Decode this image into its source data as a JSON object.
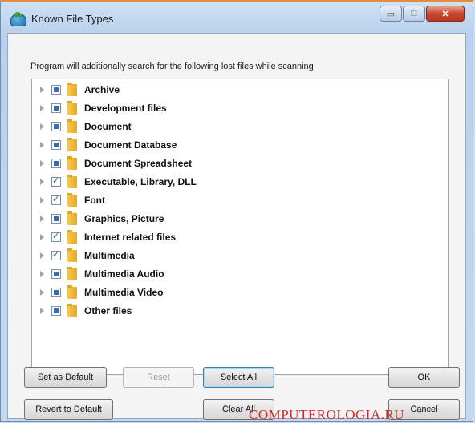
{
  "window": {
    "title": "Known File Types",
    "minimize_glyph": "▭",
    "maximize_glyph": "□",
    "close_glyph": "✕"
  },
  "instruction": "Program will additionally search for the following lost files while scanning",
  "file_types": [
    {
      "label": "Archive",
      "state": "partial"
    },
    {
      "label": "Development files",
      "state": "partial"
    },
    {
      "label": "Document",
      "state": "partial"
    },
    {
      "label": "Document Database",
      "state": "partial"
    },
    {
      "label": "Document Spreadsheet",
      "state": "partial"
    },
    {
      "label": "Executable, Library, DLL",
      "state": "checked"
    },
    {
      "label": "Font",
      "state": "checked"
    },
    {
      "label": "Graphics, Picture",
      "state": "partial"
    },
    {
      "label": "Internet related files",
      "state": "checked"
    },
    {
      "label": "Multimedia",
      "state": "checked"
    },
    {
      "label": "Multimedia Audio",
      "state": "partial"
    },
    {
      "label": "Multimedia Video",
      "state": "partial"
    },
    {
      "label": "Other files",
      "state": "partial"
    }
  ],
  "buttons": {
    "set_as_default": "Set as Default",
    "reset": "Reset",
    "select_all": "Select All",
    "ok": "OK",
    "revert_to_default": "Revert to Default",
    "clear_all": "Clear All",
    "cancel": "Cancel"
  },
  "watermark": "COMPUTEROLOGIA.RU",
  "colors": {
    "checkbox_fill": "#2e6fb5",
    "watermark": "#d12a2a",
    "close_button": "#c8452a"
  }
}
